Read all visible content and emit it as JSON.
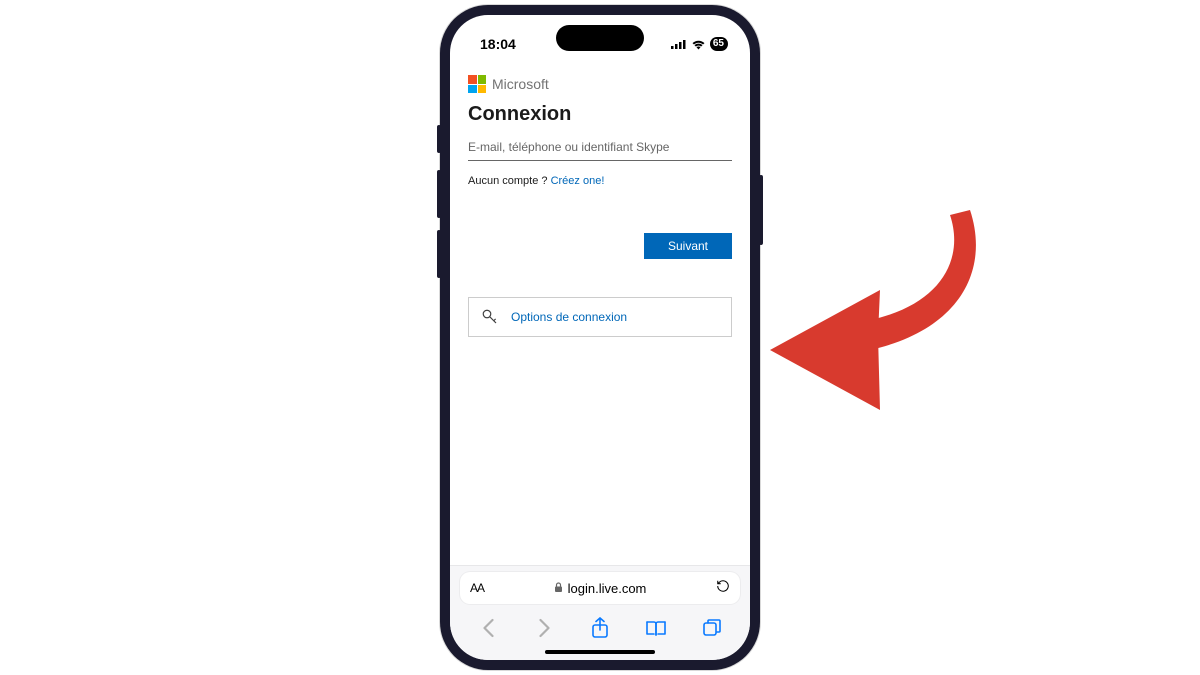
{
  "status": {
    "time": "18:04",
    "battery": "65"
  },
  "brand": {
    "name": "Microsoft"
  },
  "login": {
    "title": "Connexion",
    "placeholder": "E-mail, téléphone ou identifiant Skype",
    "no_account_prefix": "Aucun compte ? ",
    "create_link": "Créez one!",
    "next_button": "Suivant",
    "options_link": "Options de connexion"
  },
  "browser": {
    "url": "login.live.com",
    "aa": "AA"
  },
  "callout": {
    "arrow_color": "#d83a2e"
  }
}
